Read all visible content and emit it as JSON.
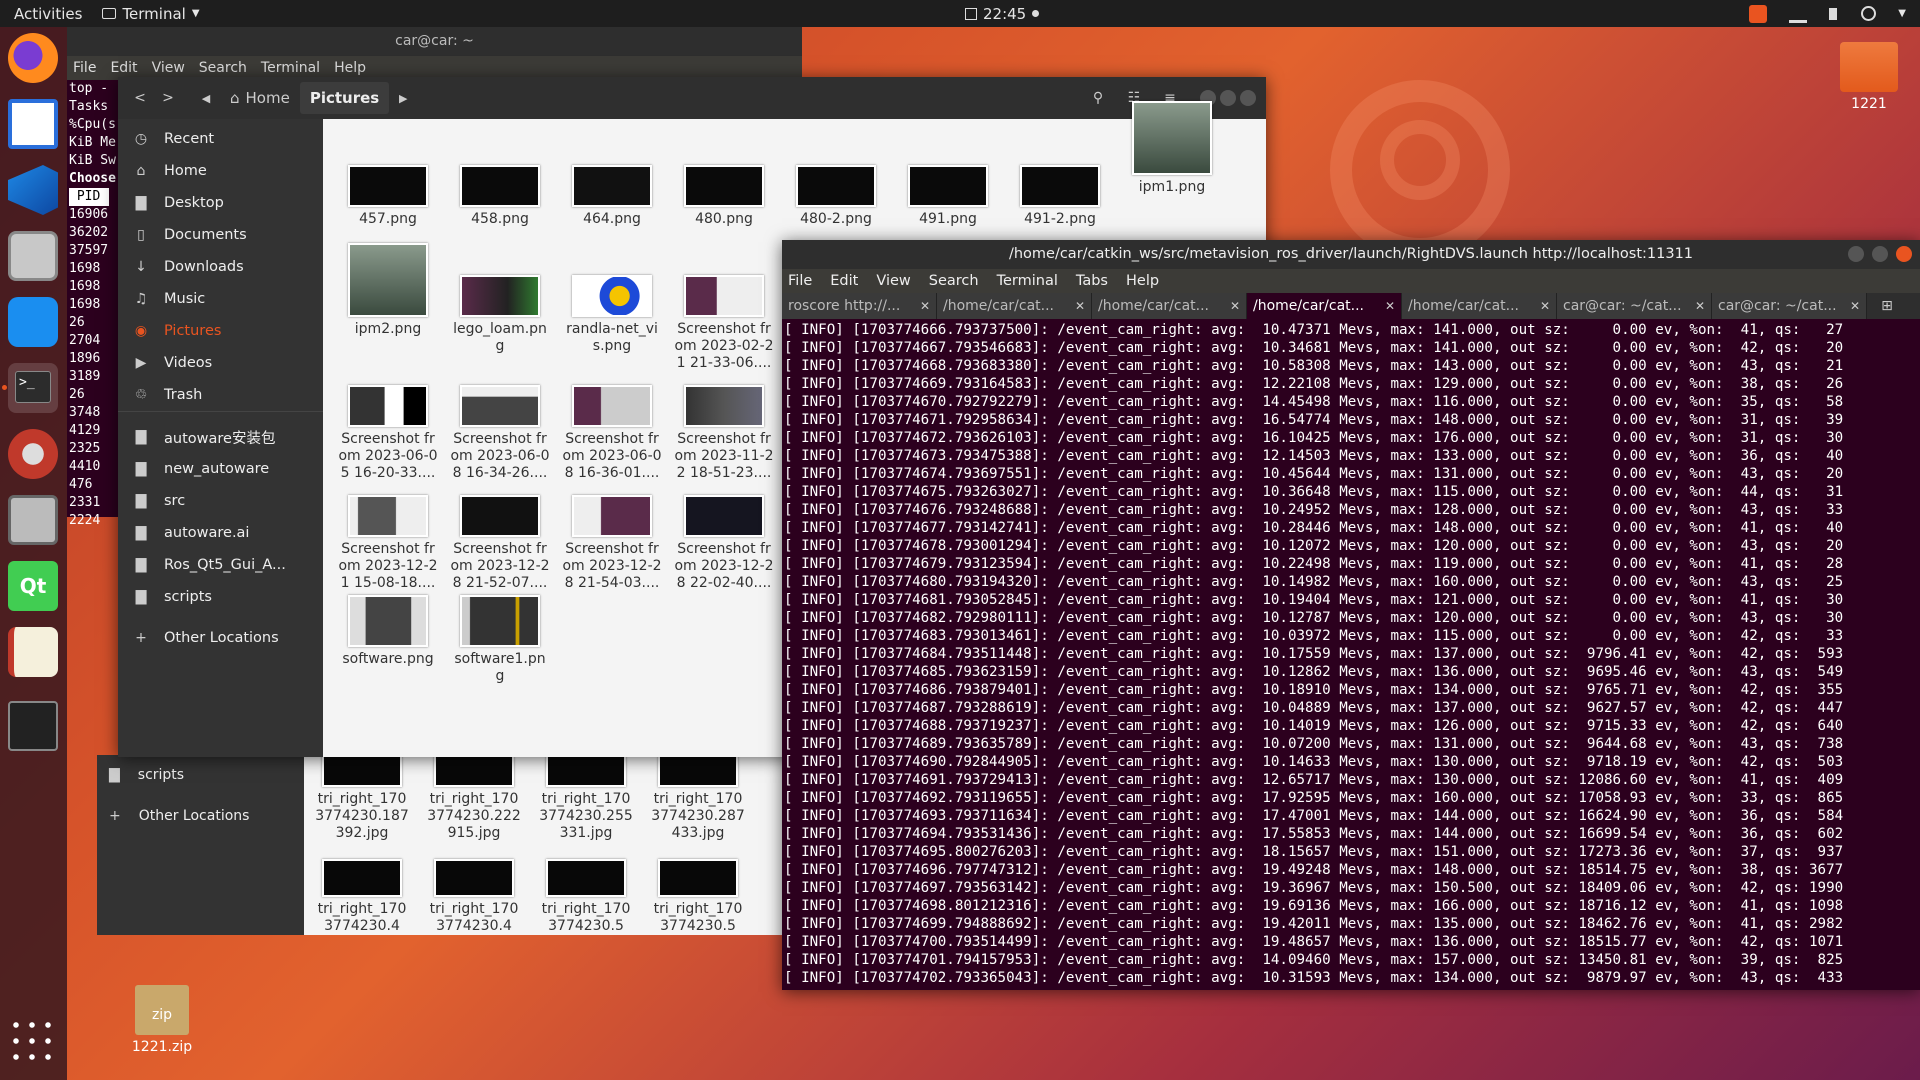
{
  "topbar": {
    "activities": "Activities",
    "app_name": "Terminal",
    "clock": "22:45"
  },
  "desktop": {
    "folder_label": "1221",
    "zip_label": "1221.zip",
    "zip_badge": "zip"
  },
  "back_terminal": {
    "title": "car@car: ~",
    "menu": [
      "File",
      "Edit",
      "View",
      "Search",
      "Terminal",
      "Help"
    ],
    "lines": [
      "top -",
      "Tasks",
      "%Cpu(s",
      "KiB Me",
      "KiB Sw",
      "Choose",
      " PID",
      "16906",
      "36202",
      "37597",
      "1698",
      "1698",
      "1698",
      "26",
      "2704",
      "1896",
      "3189",
      "26",
      "3748",
      "4129",
      "2325",
      "4410",
      "476",
      "2331",
      "2224"
    ]
  },
  "back_files": {
    "sidebar": [
      "scripts",
      "Other Locations"
    ],
    "items": [
      {
        "label": "tri_right_1703774230.187392.jpg"
      },
      {
        "label": "tri_right_1703774230.222915.jpg"
      },
      {
        "label": "tri_right_1703774230.255331.jpg"
      },
      {
        "label": "tri_right_1703774230.287433.jpg"
      },
      {
        "label": "tri_right_1703774230.4"
      },
      {
        "label": "tri_right_1703774230.4"
      },
      {
        "label": "tri_right_1703774230.5"
      },
      {
        "label": "tri_right_1703774230.5"
      }
    ]
  },
  "files": {
    "breadcrumb": {
      "home": "Home",
      "current": "Pictures"
    },
    "sidebar": [
      {
        "label": "Recent",
        "icon": "clock-icon"
      },
      {
        "label": "Home",
        "icon": "home-icon"
      },
      {
        "label": "Desktop",
        "icon": "folder-icon"
      },
      {
        "label": "Documents",
        "icon": "document-icon"
      },
      {
        "label": "Downloads",
        "icon": "download-icon"
      },
      {
        "label": "Music",
        "icon": "music-icon"
      },
      {
        "label": "Pictures",
        "icon": "camera-icon"
      },
      {
        "label": "Videos",
        "icon": "video-icon"
      },
      {
        "label": "Trash",
        "icon": "trash-icon"
      },
      {
        "label": "autoware安装包",
        "icon": "folder-icon"
      },
      {
        "label": "new_autoware",
        "icon": "folder-icon"
      },
      {
        "label": "src",
        "icon": "folder-icon"
      },
      {
        "label": "autoware.ai",
        "icon": "folder-icon"
      },
      {
        "label": "Ros_Qt5_Gui_A...",
        "icon": "folder-icon"
      },
      {
        "label": "scripts",
        "icon": "folder-icon"
      },
      {
        "label": "Other Locations",
        "icon": "plus-icon"
      }
    ],
    "items": [
      {
        "label": "457.png"
      },
      {
        "label": "458.png"
      },
      {
        "label": "464.png"
      },
      {
        "label": "480.png"
      },
      {
        "label": "480-2.png"
      },
      {
        "label": "491.png"
      },
      {
        "label": "491-2.png"
      },
      {
        "label": "ipm1.png"
      },
      {
        "label": "ipm2.png"
      },
      {
        "label": "lego_loam.png"
      },
      {
        "label": "randla-net_vis.png"
      },
      {
        "label": "Screenshot from 2023-02-21 21-33-06...."
      },
      {
        "label": "Screenshot from 2023-06-05 16-20-33...."
      },
      {
        "label": "Screenshot from 2023-06-08 16-34-26...."
      },
      {
        "label": "Screenshot from 2023-06-08 16-36-01...."
      },
      {
        "label": "Screenshot from 2023-11-22 18-51-23...."
      },
      {
        "label": "Screenshot from 2023-12-21 15-08-18...."
      },
      {
        "label": "Screenshot from 2023-12-28 21-52-07...."
      },
      {
        "label": "Screenshot from 2023-12-28 21-54-03...."
      },
      {
        "label": "Screenshot from 2023-12-28 22-02-40...."
      },
      {
        "label": "software.png"
      },
      {
        "label": "software1.png"
      }
    ]
  },
  "terminal": {
    "title": "/home/car/catkin_ws/src/metavision_ros_driver/launch/RightDVS.launch http://localhost:11311",
    "menu": [
      "File",
      "Edit",
      "View",
      "Search",
      "Terminal",
      "Tabs",
      "Help"
    ],
    "tabs": [
      {
        "label": "roscore http://..."
      },
      {
        "label": "/home/car/cat..."
      },
      {
        "label": "/home/car/cat..."
      },
      {
        "label": "/home/car/cat..."
      },
      {
        "label": "/home/car/cat..."
      },
      {
        "label": "car@car: ~/cat..."
      },
      {
        "label": "car@car: ~/cat..."
      }
    ],
    "lines": [
      "[ INFO] [1703774666.793737500]: /event_cam_right: avg:  10.47371 Mevs, max: 141.000, out sz:     0.00 ev, %on:  41, qs:   27",
      "[ INFO] [1703774667.793546683]: /event_cam_right: avg:  10.34681 Mevs, max: 141.000, out sz:     0.00 ev, %on:  42, qs:   20",
      "[ INFO] [1703774668.793683380]: /event_cam_right: avg:  10.58308 Mevs, max: 143.000, out sz:     0.00 ev, %on:  43, qs:   21",
      "[ INFO] [1703774669.793164583]: /event_cam_right: avg:  12.22108 Mevs, max: 129.000, out sz:     0.00 ev, %on:  38, qs:   26",
      "[ INFO] [1703774670.792792279]: /event_cam_right: avg:  14.45498 Mevs, max: 116.000, out sz:     0.00 ev, %on:  35, qs:   58",
      "[ INFO] [1703774671.792958634]: /event_cam_right: avg:  16.54774 Mevs, max: 148.000, out sz:     0.00 ev, %on:  31, qs:   39",
      "[ INFO] [1703774672.793626103]: /event_cam_right: avg:  16.10425 Mevs, max: 176.000, out sz:     0.00 ev, %on:  31, qs:   30",
      "[ INFO] [1703774673.793475388]: /event_cam_right: avg:  12.14503 Mevs, max: 133.000, out sz:     0.00 ev, %on:  36, qs:   40",
      "[ INFO] [1703774674.793697551]: /event_cam_right: avg:  10.45644 Mevs, max: 131.000, out sz:     0.00 ev, %on:  43, qs:   20",
      "[ INFO] [1703774675.793263027]: /event_cam_right: avg:  10.36648 Mevs, max: 115.000, out sz:     0.00 ev, %on:  44, qs:   31",
      "[ INFO] [1703774676.793248688]: /event_cam_right: avg:  10.24952 Mevs, max: 128.000, out sz:     0.00 ev, %on:  43, qs:   33",
      "[ INFO] [1703774677.793142741]: /event_cam_right: avg:  10.28446 Mevs, max: 148.000, out sz:     0.00 ev, %on:  41, qs:   40",
      "[ INFO] [1703774678.793001294]: /event_cam_right: avg:  10.12072 Mevs, max: 120.000, out sz:     0.00 ev, %on:  43, qs:   20",
      "[ INFO] [1703774679.793123594]: /event_cam_right: avg:  10.22498 Mevs, max: 119.000, out sz:     0.00 ev, %on:  41, qs:   28",
      "[ INFO] [1703774680.793194320]: /event_cam_right: avg:  10.14982 Mevs, max: 160.000, out sz:     0.00 ev, %on:  43, qs:   25",
      "[ INFO] [1703774681.793052845]: /event_cam_right: avg:  10.19404 Mevs, max: 121.000, out sz:     0.00 ev, %on:  41, qs:   30",
      "[ INFO] [1703774682.792980111]: /event_cam_right: avg:  10.12787 Mevs, max: 120.000, out sz:     0.00 ev, %on:  43, qs:   30",
      "[ INFO] [1703774683.793013461]: /event_cam_right: avg:  10.03972 Mevs, max: 115.000, out sz:     0.00 ev, %on:  42, qs:   33",
      "[ INFO] [1703774684.793511448]: /event_cam_right: avg:  10.17559 Mevs, max: 137.000, out sz:  9796.41 ev, %on:  42, qs:  593",
      "[ INFO] [1703774685.793623159]: /event_cam_right: avg:  10.12862 Mevs, max: 136.000, out sz:  9695.46 ev, %on:  43, qs:  549",
      "[ INFO] [1703774686.793879401]: /event_cam_right: avg:  10.18910 Mevs, max: 134.000, out sz:  9765.71 ev, %on:  42, qs:  355",
      "[ INFO] [1703774687.793288619]: /event_cam_right: avg:  10.04889 Mevs, max: 137.000, out sz:  9627.57 ev, %on:  42, qs:  447",
      "[ INFO] [1703774688.793719237]: /event_cam_right: avg:  10.14019 Mevs, max: 126.000, out sz:  9715.33 ev, %on:  42, qs:  640",
      "[ INFO] [1703774689.793635789]: /event_cam_right: avg:  10.07200 Mevs, max: 131.000, out sz:  9644.68 ev, %on:  43, qs:  738",
      "[ INFO] [1703774690.792844905]: /event_cam_right: avg:  10.14633 Mevs, max: 130.000, out sz:  9718.19 ev, %on:  42, qs:  503",
      "[ INFO] [1703774691.793729413]: /event_cam_right: avg:  12.65717 Mevs, max: 130.000, out sz: 12086.60 ev, %on:  41, qs:  409",
      "[ INFO] [1703774692.793119655]: /event_cam_right: avg:  17.92595 Mevs, max: 160.000, out sz: 17058.93 ev, %on:  33, qs:  865",
      "[ INFO] [1703774693.793711634]: /event_cam_right: avg:  17.47001 Mevs, max: 144.000, out sz: 16624.90 ev, %on:  36, qs:  584",
      "[ INFO] [1703774694.793531436]: /event_cam_right: avg:  17.55853 Mevs, max: 144.000, out sz: 16699.54 ev, %on:  36, qs:  602",
      "[ INFO] [1703774695.800276203]: /event_cam_right: avg:  18.15657 Mevs, max: 151.000, out sz: 17273.36 ev, %on:  37, qs:  937",
      "[ INFO] [1703774696.797747312]: /event_cam_right: avg:  19.49248 Mevs, max: 148.000, out sz: 18514.75 ev, %on:  38, qs: 3677",
      "[ INFO] [1703774697.793563142]: /event_cam_right: avg:  19.36967 Mevs, max: 150.500, out sz: 18409.06 ev, %on:  42, qs: 1990",
      "[ INFO] [1703774698.801212316]: /event_cam_right: avg:  19.69136 Mevs, max: 166.000, out sz: 18716.12 ev, %on:  41, qs: 1098",
      "[ INFO] [1703774699.794888692]: /event_cam_right: avg:  19.42011 Mevs, max: 135.000, out sz: 18462.76 ev, %on:  41, qs: 2982",
      "[ INFO] [1703774700.793514499]: /event_cam_right: avg:  19.48657 Mevs, max: 136.000, out sz: 18515.77 ev, %on:  42, qs: 1071",
      "[ INFO] [1703774701.794157953]: /event_cam_right: avg:  14.09460 Mevs, max: 157.000, out sz: 13450.81 ev, %on:  39, qs:  825",
      "[ INFO] [1703774702.793365043]: /event_cam_right: avg:  10.31593 Mevs, max: 134.000, out sz:  9879.97 ev, %on:  43, qs:  433"
    ]
  }
}
